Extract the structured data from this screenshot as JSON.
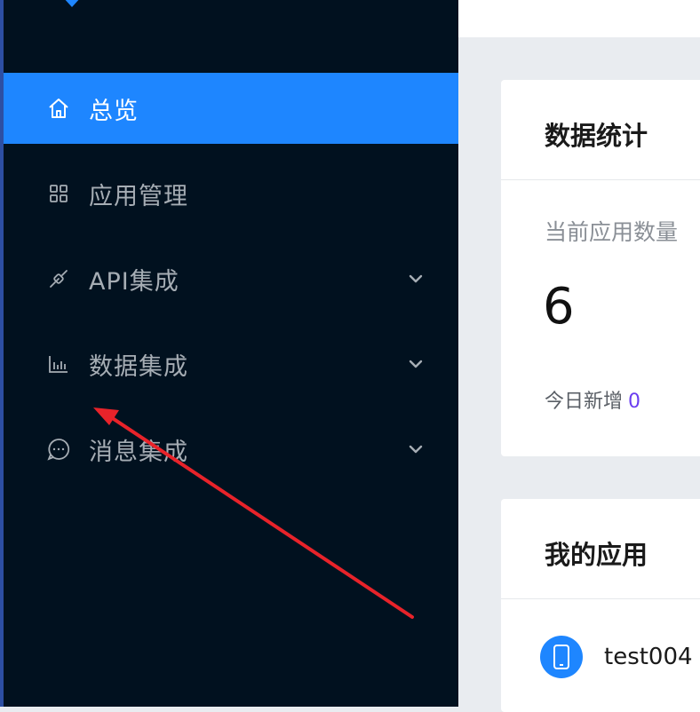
{
  "sidebar": {
    "items": [
      {
        "label": "总览",
        "icon": "home-icon",
        "active": true
      },
      {
        "label": "应用管理",
        "icon": "grid-apps-icon"
      },
      {
        "label": "API集成",
        "icon": "plug-link-icon",
        "expandable": true
      },
      {
        "label": "数据集成",
        "icon": "bar-chart-icon",
        "expandable": true
      },
      {
        "label": "消息集成",
        "icon": "chat-bubble-icon",
        "expandable": true
      }
    ]
  },
  "stats_card": {
    "title": "数据统计",
    "current_count_label": "当前应用数量",
    "current_count_value": "6",
    "today_new_label": "今日新增",
    "today_new_value": "0"
  },
  "apps_card": {
    "title": "我的应用",
    "apps": [
      {
        "name": "test004",
        "icon": "mobile-phone-icon"
      }
    ]
  },
  "colors": {
    "sidebar_bg": "#01111f",
    "active_item": "#1e86ff",
    "annotation_arrow": "#e8232a",
    "accent_number": "#6a3df0"
  }
}
